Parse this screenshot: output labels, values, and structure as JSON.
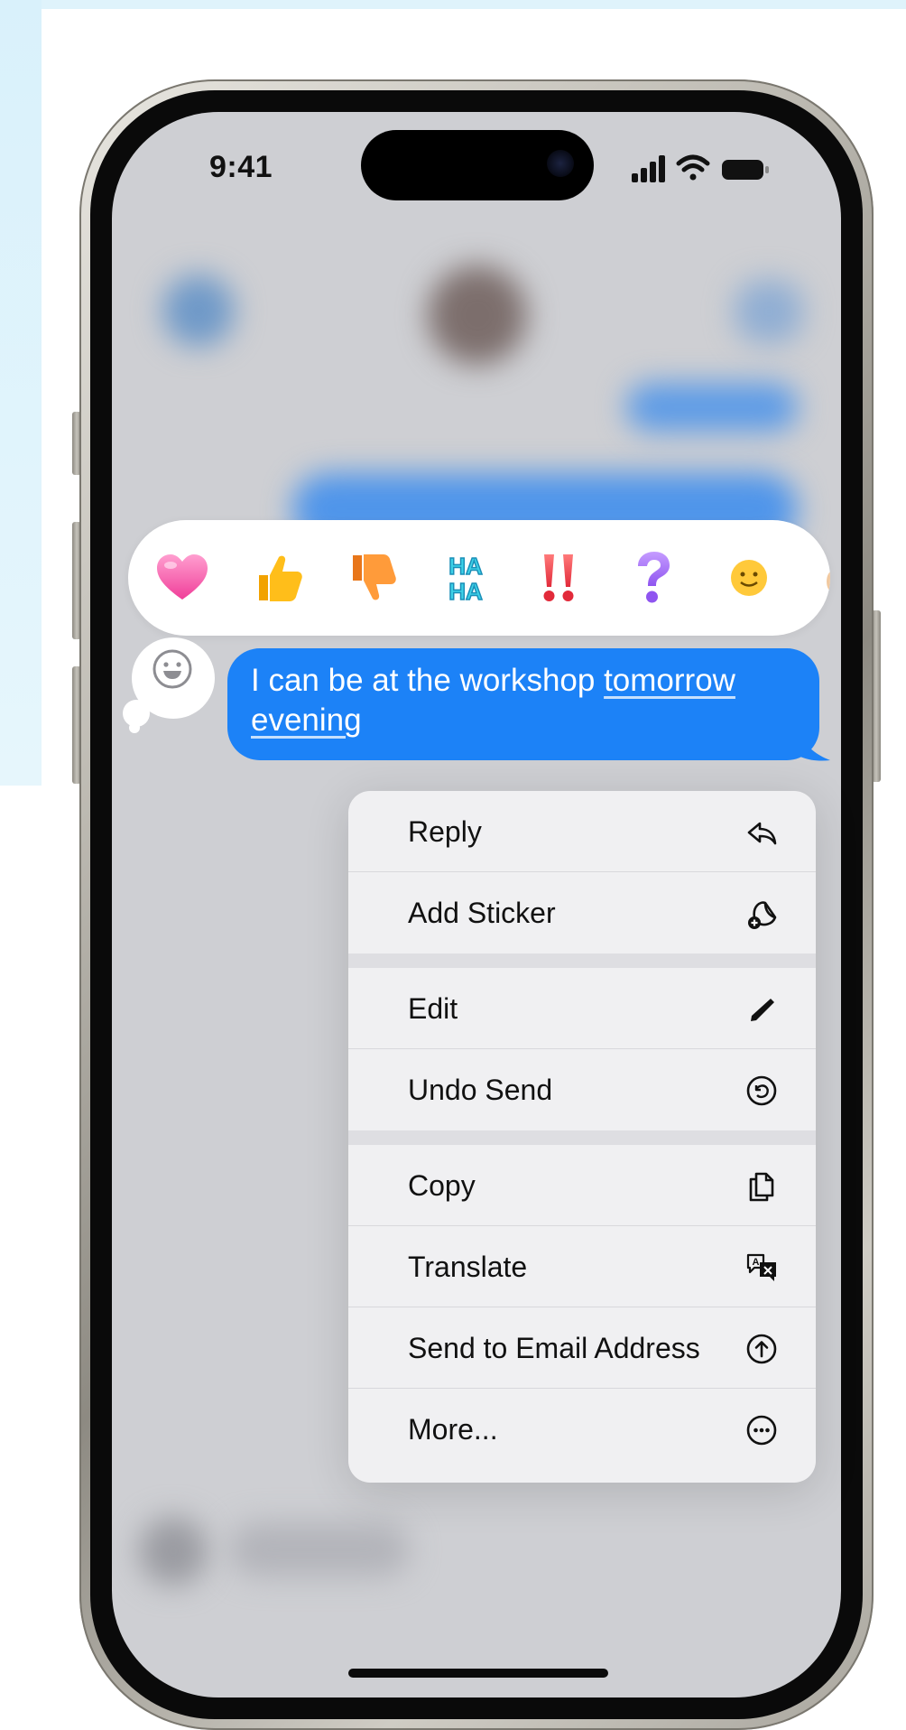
{
  "status_bar": {
    "time": "9:41"
  },
  "reactions": [
    {
      "name": "heart-reaction"
    },
    {
      "name": "thumbs-up-reaction"
    },
    {
      "name": "thumbs-down-reaction"
    },
    {
      "name": "haha-reaction"
    },
    {
      "name": "exclamation-reaction"
    },
    {
      "name": "question-reaction"
    },
    {
      "name": "emoji-face-reaction"
    }
  ],
  "haha_text": {
    "top": "HA",
    "bottom": "HA"
  },
  "message": {
    "text_before": "I can be at the workshop ",
    "link_1": "tomorrow",
    "link_2": "evening"
  },
  "menu": {
    "reply": "Reply",
    "add_sticker": "Add Sticker",
    "edit": "Edit",
    "undo_send": "Undo Send",
    "copy": "Copy",
    "translate": "Translate",
    "send_to_email": "Send to Email Address",
    "more": "More..."
  },
  "colors": {
    "bubble_blue": "#1c82f7",
    "menu_bg": "#f0f0f2",
    "reaction_bar_bg": "#ffffff"
  }
}
